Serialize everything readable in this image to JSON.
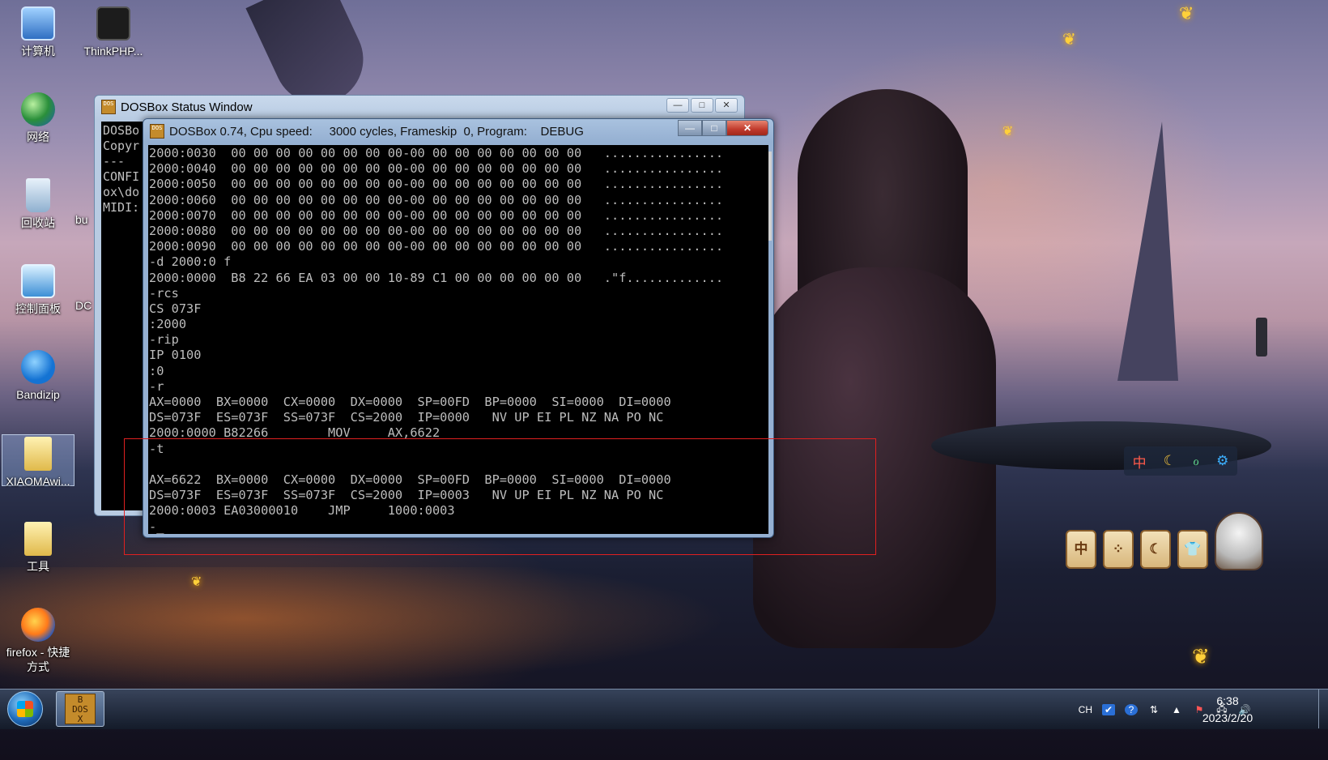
{
  "desktop": {
    "icons": [
      {
        "label": "计算机",
        "icon": "computer-icon"
      },
      {
        "label": "ThinkPHP...",
        "icon": "monitor-icon"
      },
      {
        "label": "网络",
        "icon": "network-icon"
      },
      {
        "label": "回收站",
        "icon": "recycle-bin-icon"
      },
      {
        "label": "控制面板",
        "icon": "control-panel-icon"
      },
      {
        "label": "Bandizip",
        "icon": "bandizip-icon"
      },
      {
        "label": "XIAOMAwi...",
        "icon": "folder-icon"
      },
      {
        "label": "工具",
        "icon": "folder-icon"
      },
      {
        "label": "firefox - 快捷方式",
        "icon": "firefox-icon"
      }
    ],
    "partial_labels": [
      "bu",
      "DC"
    ]
  },
  "status_window": {
    "title": "DOSBox Status Window",
    "lines": [
      "DOSBo",
      "Copyr",
      "---",
      "CONFI",
      "ox\\do",
      "MIDI:"
    ],
    "controls": {
      "minimize": "—",
      "maximize": "□",
      "close": "✕"
    }
  },
  "dosbox_window": {
    "title": "DOSBox 0.74, Cpu speed:     3000 cycles, Frameskip  0, Program:    DEBUG",
    "controls": {
      "minimize": "—",
      "maximize": "□",
      "close": "✕"
    },
    "screen_lines": [
      "2000:0030  00 00 00 00 00 00 00 00-00 00 00 00 00 00 00 00   ................",
      "2000:0040  00 00 00 00 00 00 00 00-00 00 00 00 00 00 00 00   ................",
      "2000:0050  00 00 00 00 00 00 00 00-00 00 00 00 00 00 00 00   ................",
      "2000:0060  00 00 00 00 00 00 00 00-00 00 00 00 00 00 00 00   ................",
      "2000:0070  00 00 00 00 00 00 00 00-00 00 00 00 00 00 00 00   ................",
      "2000:0080  00 00 00 00 00 00 00 00-00 00 00 00 00 00 00 00   ................",
      "2000:0090  00 00 00 00 00 00 00 00-00 00 00 00 00 00 00 00   ................",
      "-d 2000:0 f",
      "2000:0000  B8 22 66 EA 03 00 00 10-89 C1 00 00 00 00 00 00   .\"f.............",
      "-rcs",
      "CS 073F",
      ":2000",
      "-rip",
      "IP 0100",
      ":0",
      "-r",
      "AX=0000  BX=0000  CX=0000  DX=0000  SP=00FD  BP=0000  SI=0000  DI=0000",
      "DS=073F  ES=073F  SS=073F  CS=2000  IP=0000   NV UP EI PL NZ NA PO NC",
      "2000:0000 B82266        MOV     AX,6622",
      "-t",
      "",
      "AX=6622  BX=0000  CX=0000  DX=0000  SP=00FD  BP=0000  SI=0000  DI=0000",
      "DS=073F  ES=073F  SS=073F  CS=2000  IP=0003   NV UP EI PL NZ NA PO NC",
      "2000:0003 EA03000010    JMP     1000:0003",
      "-_"
    ]
  },
  "widgets": {
    "ime_bar": [
      "中",
      "☾",
      "ℴ",
      "⚙"
    ],
    "scroll_cards": [
      "中",
      "⁘",
      "☾",
      "👕"
    ]
  },
  "taskbar": {
    "dos_icon_text": "B\nDOS\nX",
    "tray": [
      "CH",
      "✔",
      "?",
      "⇅",
      "▲",
      "⚑",
      "🖧",
      "🔊"
    ],
    "clock_time": "6:38",
    "clock_date": "2023/2/20"
  }
}
